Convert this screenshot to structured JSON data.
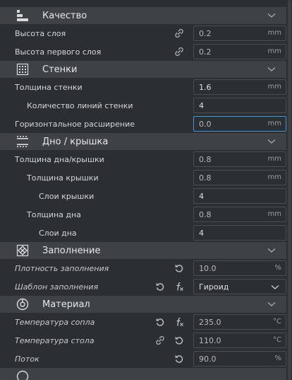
{
  "sections": {
    "quality": {
      "title": "Качество"
    },
    "walls": {
      "title": "Стенки"
    },
    "bottomtop": {
      "title": "Дно / крышка"
    },
    "infill": {
      "title": "Заполнение"
    },
    "material": {
      "title": "Материал"
    }
  },
  "rows": {
    "layer_height": {
      "label": "Высота слоя",
      "value": "0.2",
      "unit": "mm"
    },
    "initial_layer_height": {
      "label": "Высота первого слоя",
      "value": "0.2",
      "unit": "mm"
    },
    "wall_thickness": {
      "label": "Толщина стенки",
      "value": "1.6",
      "unit": "mm"
    },
    "wall_line_count": {
      "label": "Количество линий стенки",
      "value": "4"
    },
    "horizontal_expansion": {
      "label": "Горизонтальное расширение",
      "value": "0.0",
      "unit": "mm"
    },
    "top_bottom_thickness": {
      "label": "Толщина дна/крышки",
      "value": "0.8",
      "unit": "mm"
    },
    "top_thickness": {
      "label": "Толщина крышки",
      "value": "0.8",
      "unit": "mm"
    },
    "top_layers": {
      "label": "Слои крышки",
      "value": "4"
    },
    "bottom_thickness": {
      "label": "Толщина дна",
      "value": "0.8",
      "unit": "mm"
    },
    "bottom_layers": {
      "label": "Слои дна",
      "value": "4"
    },
    "infill_density": {
      "label": "Плотность заполнения",
      "value": "10.0",
      "unit": "%"
    },
    "infill_pattern": {
      "label": "Шаблон заполнения",
      "value": "Гироид"
    },
    "nozzle_temp": {
      "label": "Температура сопла",
      "value": "235.0",
      "unit": "°C"
    },
    "bed_temp": {
      "label": "Температура стола",
      "value": "110.0",
      "unit": "°C"
    },
    "flow": {
      "label": "Поток",
      "value": "90.0",
      "unit": "%"
    }
  },
  "icons": {
    "link": "link-icon",
    "reset": "reset-icon",
    "function": "function-icon",
    "collapse": "chevron-down-icon"
  },
  "colors": {
    "background": "#2b2e32",
    "header": "#3e4247",
    "field_border": "#4a4e54",
    "focus_border": "#3c9bd6"
  }
}
